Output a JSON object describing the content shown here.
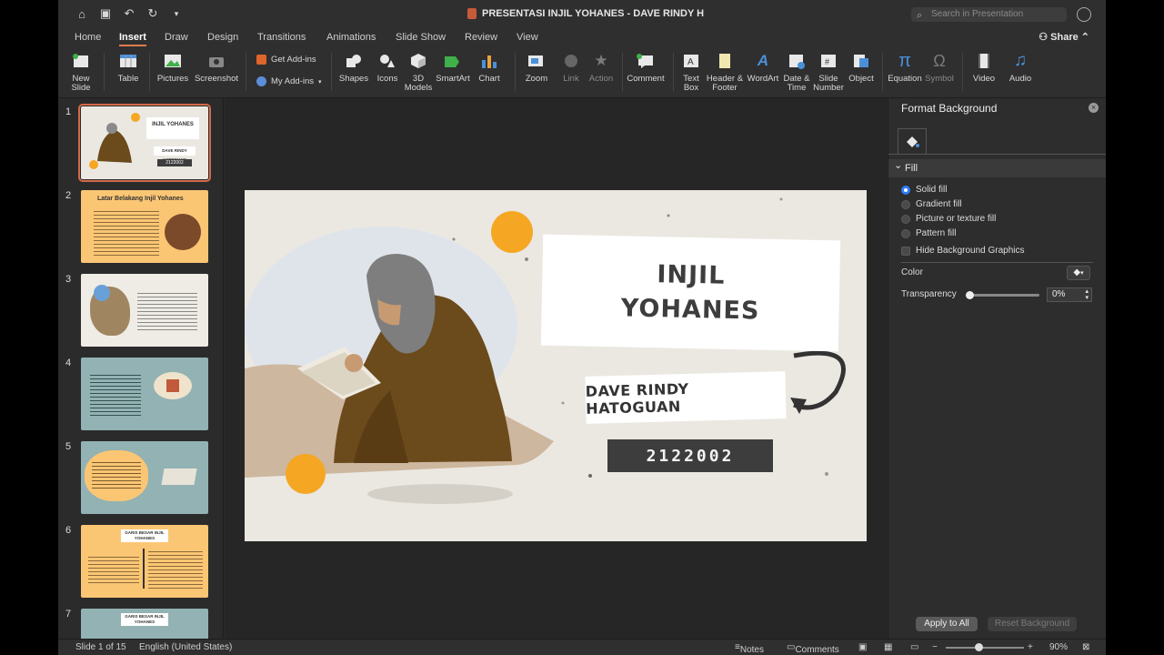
{
  "title_bar": {
    "document_title": "PRESENTASI INJIL YOHANES - DAVE RINDY H",
    "search_placeholder": "Search in Presentation"
  },
  "tabs": [
    "Home",
    "Insert",
    "Draw",
    "Design",
    "Transitions",
    "Animations",
    "Slide Show",
    "Review",
    "View"
  ],
  "active_tab": "Insert",
  "share_label": "Share",
  "ribbon": {
    "new_slide": "New\nSlide",
    "table": "Table",
    "pictures": "Pictures",
    "screenshot": "Screenshot",
    "get_addins": "Get Add-ins",
    "my_addins": "My Add-ins",
    "shapes": "Shapes",
    "icons": "Icons",
    "models_3d": "3D\nModels",
    "smartart": "SmartArt",
    "chart": "Chart",
    "zoom": "Zoom",
    "link": "Link",
    "action": "Action",
    "comment": "Comment",
    "text_box": "Text\nBox",
    "header_footer": "Header &\nFooter",
    "wordart": "WordArt",
    "date_time": "Date &\nTime",
    "slide_number": "Slide\nNumber",
    "object": "Object",
    "equation": "Equation",
    "symbol": "Symbol",
    "video": "Video",
    "audio": "Audio"
  },
  "thumbnails": [
    {
      "num": "1",
      "title": "INJIL YOHANES",
      "sub": "DAVE RINDY HATOGUAN",
      "code": "2122002"
    },
    {
      "num": "2",
      "title": "Latar Belakang Injil Yohanes"
    },
    {
      "num": "3"
    },
    {
      "num": "4"
    },
    {
      "num": "5"
    },
    {
      "num": "6",
      "title": "GARIS BESAR INJIL YOHANES"
    },
    {
      "num": "7",
      "title": "GARIS BESAR INJIL YOHANES"
    }
  ],
  "slide": {
    "title_line1": "INJIL",
    "title_line2": "YOHANES",
    "name": "DAVE RINDY HATOGUAN",
    "id_number": "2122002"
  },
  "format_pane": {
    "title": "Format Background",
    "fill_header": "Fill",
    "options": [
      "Solid fill",
      "Gradient fill",
      "Picture or texture fill",
      "Pattern fill"
    ],
    "selected_option": "Solid fill",
    "hide_bg": "Hide Background Graphics",
    "color_label": "Color",
    "transparency_label": "Transparency",
    "transparency_value": "0%",
    "apply_all": "Apply to All",
    "reset_bg": "Reset Background"
  },
  "status": {
    "slide_info": "Slide 1 of 15",
    "language": "English (United States)",
    "notes": "Notes",
    "comments": "Comments",
    "zoom": "90%"
  },
  "colors": {
    "accent_orange": "#f5a623",
    "slide_bg": "#ebe8e2",
    "dark_card": "#3d3d3d",
    "selection": "#d36a4a"
  }
}
